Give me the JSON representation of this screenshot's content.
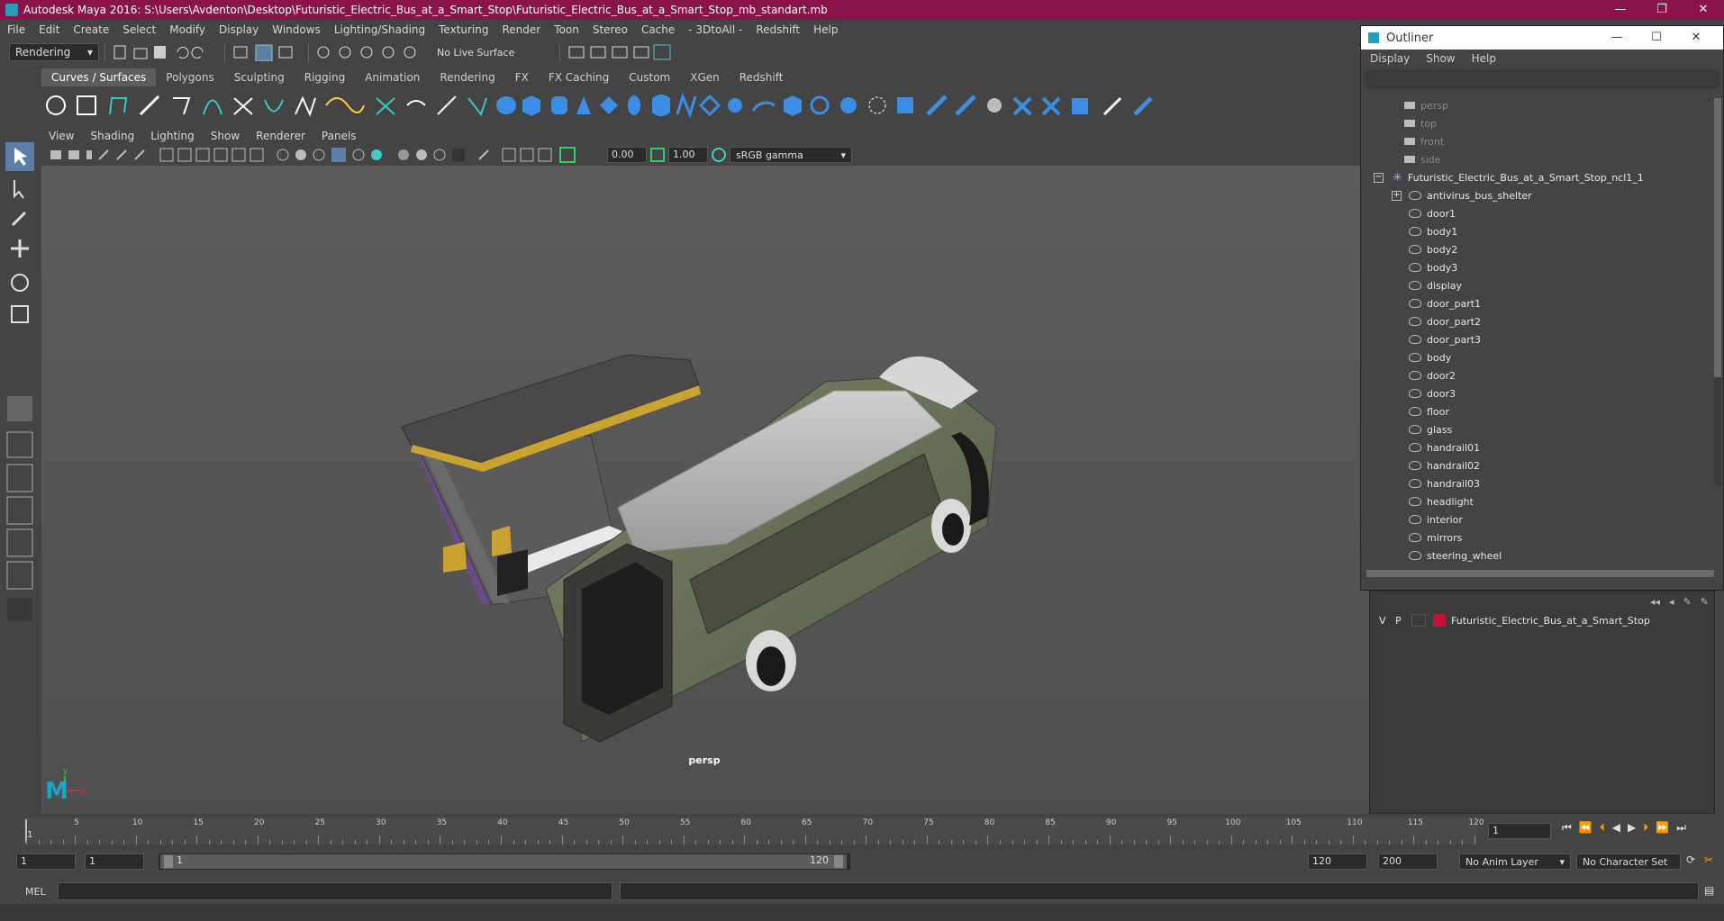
{
  "window": {
    "title": "Autodesk Maya 2016: S:\\Users\\Avdenton\\Desktop\\Futuristic_Electric_Bus_at_a_Smart_Stop\\Futuristic_Electric_Bus_at_a_Smart_Stop_mb_standart.mb",
    "minimize": "—",
    "maximize": "❐",
    "close": "✕"
  },
  "menubar": [
    "File",
    "Edit",
    "Create",
    "Select",
    "Modify",
    "Display",
    "Windows",
    "Lighting/Shading",
    "Texturing",
    "Render",
    "Toon",
    "Stereo",
    "Cache",
    "- 3DtoAll -",
    "Redshift",
    "Help"
  ],
  "statusline": {
    "mode": "Rendering",
    "live_surface": "No Live Surface"
  },
  "shelf_tabs": [
    {
      "label": "Curves / Surfaces",
      "active": true
    },
    {
      "label": "Polygons"
    },
    {
      "label": "Sculpting"
    },
    {
      "label": "Rigging"
    },
    {
      "label": "Animation"
    },
    {
      "label": "Rendering"
    },
    {
      "label": "FX"
    },
    {
      "label": "FX Caching"
    },
    {
      "label": "Custom"
    },
    {
      "label": "XGen"
    },
    {
      "label": "Redshift"
    }
  ],
  "viewport_menu": [
    "View",
    "Shading",
    "Lighting",
    "Show",
    "Renderer",
    "Panels"
  ],
  "viewport_tools": {
    "exposure": "0.00",
    "gamma": "1.00",
    "color_space": "sRGB gamma"
  },
  "viewport": {
    "camera_label": "persp",
    "axis_x": "x",
    "axis_y": "y"
  },
  "outliner": {
    "title": "Outliner",
    "minimize": "—",
    "maximize": "☐",
    "close": "✕",
    "menu": [
      "Display",
      "Show",
      "Help"
    ],
    "cameras": [
      "persp",
      "top",
      "front",
      "side"
    ],
    "root": "Futuristic_Electric_Bus_at_a_Smart_Stop_ncl1_1",
    "children": [
      "antivirus_bus_shelter",
      "door1",
      "body1",
      "body2",
      "body3",
      "display",
      "door_part1",
      "door_part2",
      "door_part3",
      "body",
      "door2",
      "door3",
      "floor",
      "glass",
      "handrail01",
      "handrail02",
      "handrail03",
      "headlight",
      "interior",
      "mirrors",
      "steering_wheel"
    ]
  },
  "layers": {
    "visible_flag": "V",
    "playback_flag": "P",
    "layer_color": "#c0143c",
    "layer_name": "Futuristic_Electric_Bus_at_a_Smart_Stop"
  },
  "timeline": {
    "ticks": [
      "5",
      "10",
      "15",
      "20",
      "25",
      "30",
      "35",
      "40",
      "45",
      "50",
      "55",
      "60",
      "65",
      "70",
      "75",
      "80",
      "85",
      "90",
      "95",
      "100",
      "105",
      "110",
      "115",
      "120"
    ],
    "start_marker": "1",
    "current_frame": "1"
  },
  "range": {
    "start": "1",
    "playback_start": "1",
    "slider_start": "1",
    "slider_end": "120",
    "playback_end": "120",
    "end": "200",
    "anim_layer": "No Anim Layer",
    "character_set": "No Character Set"
  },
  "cmdline": {
    "label": "MEL"
  },
  "colors": {
    "titlebar": "#8a1449",
    "panel": "#444444",
    "viewport_bg": "#5a5a5a",
    "accent": "#22a0b8"
  }
}
